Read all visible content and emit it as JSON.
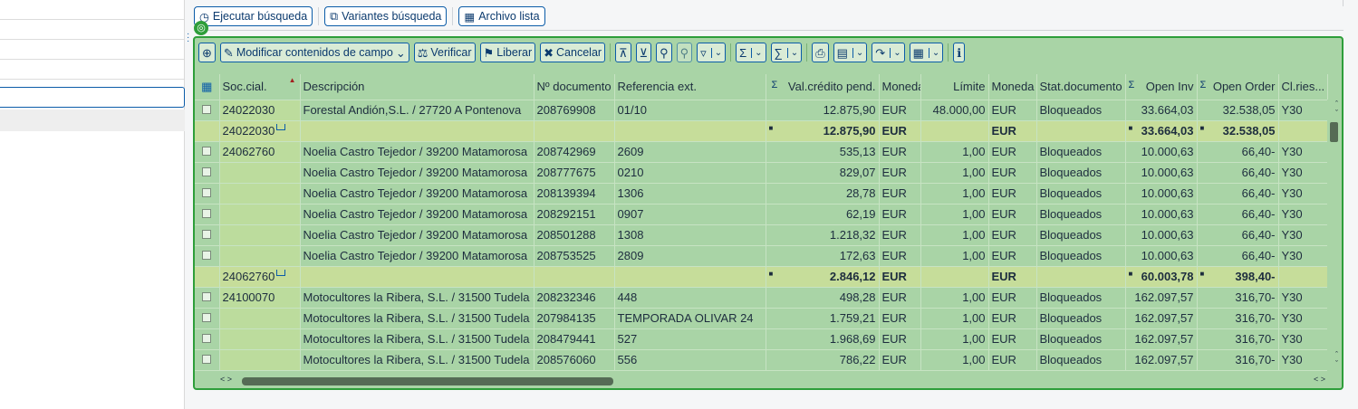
{
  "top_buttons": [
    {
      "label": "Ejecutar búsqueda",
      "icon": "clock-play-icon"
    },
    {
      "label": "Variantes búsqueda",
      "icon": "copy-icon"
    },
    {
      "label": "Archivo lista",
      "icon": "grid-icon"
    }
  ],
  "toolbar": {
    "modify": "Modificar contenidos de campo",
    "verify": "Verificar",
    "release": "Liberar",
    "cancel": "Cancelar"
  },
  "columns": [
    "Soc.cial.",
    "Descripción",
    "Nº documento",
    "Referencia ext.",
    "Val.crédito pend.",
    "Moneda",
    "Límite",
    "Moneda",
    "Stat.documento",
    "Open Inv",
    "Open Order",
    "Cl.ries..."
  ],
  "rows": [
    {
      "type": "item",
      "soc": "24022030",
      "desc": "Forestal Andión,S.L. / 27720 A Pontenova",
      "doc": "208769908",
      "ref": "01/10",
      "val": "12.875,90",
      "cur": "EUR",
      "lim": "48.000,00",
      "cur2": "EUR",
      "stat": "Bloqueados",
      "inv": "33.664,03",
      "ord": "32.538,05",
      "cl": "Y30"
    },
    {
      "type": "sub",
      "soc": "24022030",
      "val": "12.875,90",
      "cur": "EUR",
      "cur2": "EUR",
      "inv": "33.664,03",
      "ord": "32.538,05"
    },
    {
      "type": "item",
      "soc": "24062760",
      "desc": "Noelia Castro Tejedor / 39200 Matamorosa",
      "doc": "208742969",
      "ref": "2609",
      "val": "535,13",
      "cur": "EUR",
      "lim": "1,00",
      "cur2": "EUR",
      "stat": "Bloqueados",
      "inv": "10.000,63",
      "ord": "66,40-",
      "cl": "Y30"
    },
    {
      "type": "item",
      "soc": "",
      "desc": "Noelia Castro Tejedor / 39200 Matamorosa",
      "doc": "208777675",
      "ref": "0210",
      "val": "829,07",
      "cur": "EUR",
      "lim": "1,00",
      "cur2": "EUR",
      "stat": "Bloqueados",
      "inv": "10.000,63",
      "ord": "66,40-",
      "cl": "Y30"
    },
    {
      "type": "item",
      "soc": "",
      "desc": "Noelia Castro Tejedor / 39200 Matamorosa",
      "doc": "208139394",
      "ref": "1306",
      "val": "28,78",
      "cur": "EUR",
      "lim": "1,00",
      "cur2": "EUR",
      "stat": "Bloqueados",
      "inv": "10.000,63",
      "ord": "66,40-",
      "cl": "Y30"
    },
    {
      "type": "item",
      "soc": "",
      "desc": "Noelia Castro Tejedor / 39200 Matamorosa",
      "doc": "208292151",
      "ref": "0907",
      "val": "62,19",
      "cur": "EUR",
      "lim": "1,00",
      "cur2": "EUR",
      "stat": "Bloqueados",
      "inv": "10.000,63",
      "ord": "66,40-",
      "cl": "Y30"
    },
    {
      "type": "item",
      "soc": "",
      "desc": "Noelia Castro Tejedor / 39200 Matamorosa",
      "doc": "208501288",
      "ref": "1308",
      "val": "1.218,32",
      "cur": "EUR",
      "lim": "1,00",
      "cur2": "EUR",
      "stat": "Bloqueados",
      "inv": "10.000,63",
      "ord": "66,40-",
      "cl": "Y30"
    },
    {
      "type": "item",
      "soc": "",
      "desc": "Noelia Castro Tejedor / 39200 Matamorosa",
      "doc": "208753525",
      "ref": "2809",
      "val": "172,63",
      "cur": "EUR",
      "lim": "1,00",
      "cur2": "EUR",
      "stat": "Bloqueados",
      "inv": "10.000,63",
      "ord": "66,40-",
      "cl": "Y30"
    },
    {
      "type": "sub",
      "soc": "24062760",
      "val": "2.846,12",
      "cur": "EUR",
      "cur2": "EUR",
      "inv": "60.003,78",
      "ord": "398,40-"
    },
    {
      "type": "item",
      "soc": "24100070",
      "desc": "Motocultores la Ribera, S.L. / 31500 Tudela",
      "doc": "208232346",
      "ref": "448",
      "val": "498,28",
      "cur": "EUR",
      "lim": "1,00",
      "cur2": "EUR",
      "stat": "Bloqueados",
      "inv": "162.097,57",
      "ord": "316,70-",
      "cl": "Y30"
    },
    {
      "type": "item",
      "soc": "",
      "desc": "Motocultores la Ribera, S.L. / 31500 Tudela",
      "doc": "207984135",
      "ref": "TEMPORADA OLIVAR 24",
      "val": "1.759,21",
      "cur": "EUR",
      "lim": "1,00",
      "cur2": "EUR",
      "stat": "Bloqueados",
      "inv": "162.097,57",
      "ord": "316,70-",
      "cl": "Y30"
    },
    {
      "type": "item",
      "soc": "",
      "desc": "Motocultores la Ribera, S.L. / 31500 Tudela",
      "doc": "208479441",
      "ref": "527",
      "val": "1.968,69",
      "cur": "EUR",
      "lim": "1,00",
      "cur2": "EUR",
      "stat": "Bloqueados",
      "inv": "162.097,57",
      "ord": "316,70-",
      "cl": "Y30"
    },
    {
      "type": "item",
      "soc": "",
      "desc": "Motocultores la Ribera, S.L. / 31500 Tudela",
      "doc": "208576060",
      "ref": "556",
      "val": "786,22",
      "cur": "EUR",
      "lim": "1,00",
      "cur2": "EUR",
      "stat": "Bloqueados",
      "inv": "162.097,57",
      "ord": "316,70-",
      "cl": "Y30"
    }
  ],
  "colors": {
    "panel_bg": "#a9d4a6",
    "panel_border": "#2e9e3a",
    "subtotal_bg": "#c6dd9a",
    "link": "#0b5ca8"
  }
}
